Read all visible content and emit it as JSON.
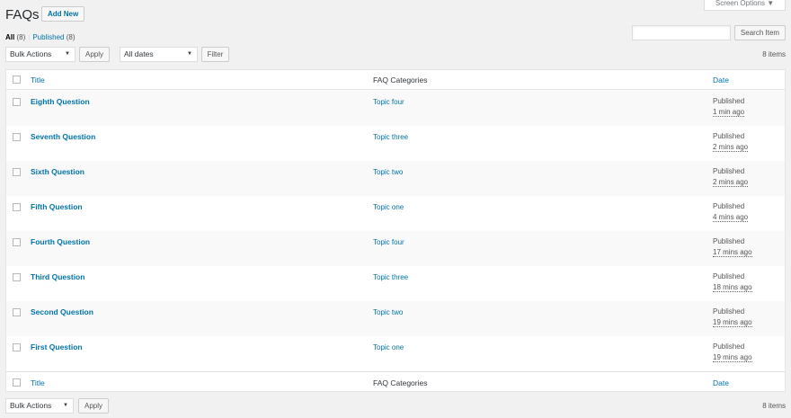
{
  "header": {
    "title": "FAQs",
    "add_new": "Add New",
    "screen_options": "Screen Options ▼"
  },
  "views": {
    "all_label": "All",
    "all_count": "(8)",
    "separator": "|",
    "published_label": "Published",
    "published_count": "(8)"
  },
  "search": {
    "value": "",
    "button": "Search Item"
  },
  "top_nav": {
    "bulk_actions": "Bulk Actions",
    "apply": "Apply",
    "dates": "All dates",
    "filter": "Filter",
    "items_count": "8 items"
  },
  "bottom_nav": {
    "bulk_actions": "Bulk Actions",
    "apply": "Apply",
    "items_count": "8 items"
  },
  "table": {
    "columns": {
      "title": "Title",
      "categories": "FAQ Categories",
      "date": "Date"
    },
    "rows": [
      {
        "title": "Eighth Question",
        "category": "Topic four",
        "status": "Published",
        "date": "1 min ago"
      },
      {
        "title": "Seventh Question",
        "category": "Topic three",
        "status": "Published",
        "date": "2 mins ago"
      },
      {
        "title": "Sixth Question",
        "category": "Topic two",
        "status": "Published",
        "date": "2 mins ago"
      },
      {
        "title": "Fifth Question",
        "category": "Topic one",
        "status": "Published",
        "date": "4 mins ago"
      },
      {
        "title": "Fourth Question",
        "category": "Topic four",
        "status": "Published",
        "date": "17 mins ago"
      },
      {
        "title": "Third Question",
        "category": "Topic three",
        "status": "Published",
        "date": "18 mins ago"
      },
      {
        "title": "Second Question",
        "category": "Topic two",
        "status": "Published",
        "date": "19 mins ago"
      },
      {
        "title": "First Question",
        "category": "Topic one",
        "status": "Published",
        "date": "19 mins ago"
      }
    ]
  },
  "colors": {
    "link": "#0073aa",
    "background": "#f1f1f1",
    "row_alt": "#f9f9f9"
  }
}
